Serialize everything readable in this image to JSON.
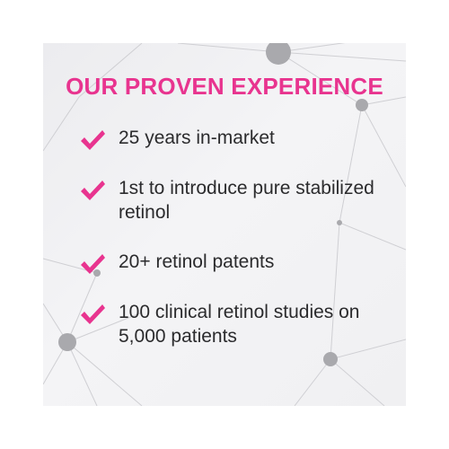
{
  "title": "OUR PROVEN EXPERIENCE",
  "items": [
    {
      "label": "25 years in-market",
      "icon": "checkmark-icon"
    },
    {
      "label": "1st to introduce pure stabilized retinol",
      "icon": "checkmark-icon"
    },
    {
      "label": "20+ retinol patents",
      "icon": "checkmark-icon"
    },
    {
      "label": "100 clinical retinol studies on 5,000 patients",
      "icon": "checkmark-icon"
    }
  ],
  "colors": {
    "accent": "#e8348f",
    "text": "#2b2b2d",
    "background": "#f0f0f2",
    "node": "#a9a9ad",
    "line": "#cfcfd3"
  }
}
